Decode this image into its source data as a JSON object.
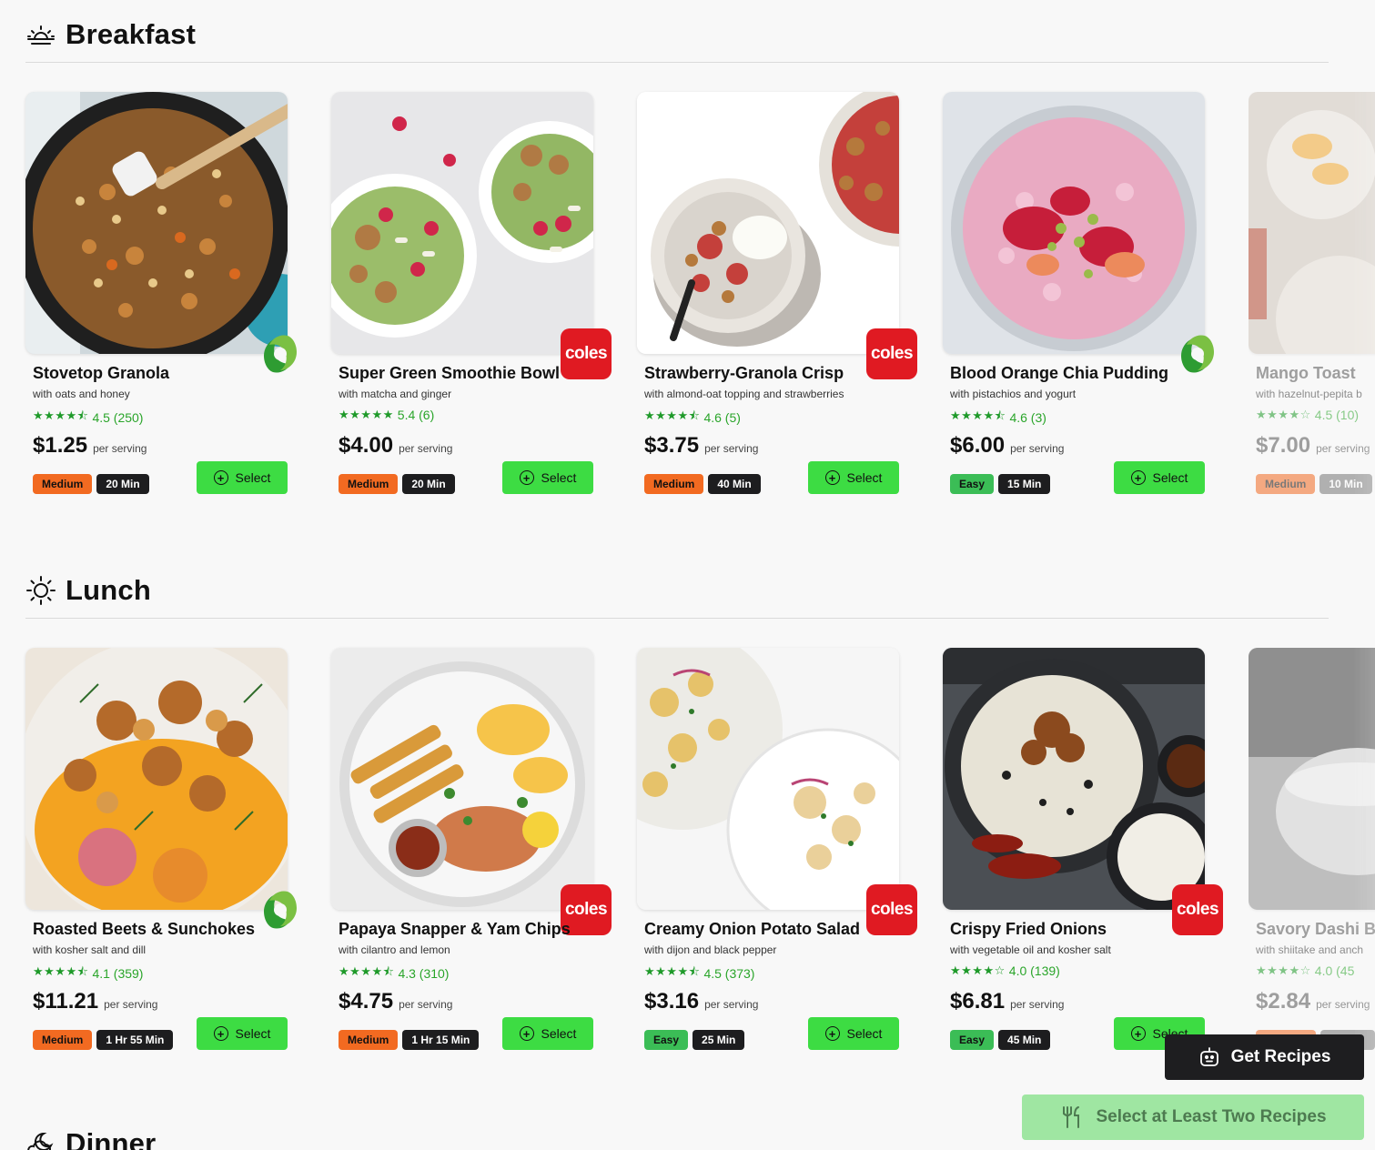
{
  "colors": {
    "accent_green": "#3ddc43",
    "difficulty_medium": "#f26a21",
    "difficulty_easy": "#3bbd56",
    "coles_red": "#e01a22",
    "woolworths_green": "#35a83b"
  },
  "common": {
    "select_label": "Select",
    "per_serving": "per serving"
  },
  "sections": [
    {
      "title": "Breakfast",
      "icon": "sunrise-icon",
      "recipes": [
        {
          "name": "Stovetop Granola",
          "sub": "with oats and honey",
          "stars": "★★★★⯪",
          "rating": "4.5 (250)",
          "price": "$1.25",
          "difficulty": "Medium",
          "time": "20 Min",
          "store": "woolworths",
          "image": "granola-skillet"
        },
        {
          "name": "Super Green Smoothie Bowl",
          "sub": "with matcha and ginger",
          "stars": "★★★★★",
          "rating": "5.4 (6)",
          "price": "$4.00",
          "difficulty": "Medium",
          "time": "20 Min",
          "store": "coles",
          "store_label": "coles",
          "image": "smoothie-bowls"
        },
        {
          "name": "Strawberry-Granola Crisp",
          "sub": "with almond-oat topping and strawberries",
          "stars": "★★★★⯪",
          "rating": "4.6 (5)",
          "price": "$3.75",
          "difficulty": "Medium",
          "time": "40 Min",
          "store": "coles",
          "store_label": "coles",
          "image": "strawberry-crisp"
        },
        {
          "name": "Blood Orange Chia Pudding",
          "sub": "with pistachios and yogurt",
          "stars": "★★★★⯪",
          "rating": "4.6 (3)",
          "price": "$6.00",
          "difficulty": "Easy",
          "time": "15 Min",
          "store": "woolworths",
          "image": "chia-pudding"
        },
        {
          "name": "Mango Toast",
          "sub": "with hazelnut-pepita b",
          "stars": "★★★★☆",
          "rating": "4.5 (10)",
          "price": "$7.00",
          "difficulty": "Medium",
          "time": "10 Min",
          "store": "",
          "image": "mango-toast"
        }
      ]
    },
    {
      "title": "Lunch",
      "icon": "sun-icon",
      "recipes": [
        {
          "name": "Roasted Beets & Sunchokes",
          "sub": "with kosher salt and dill",
          "stars": "★★★★⯪",
          "rating": "4.1 (359)",
          "price": "$11.21",
          "difficulty": "Medium",
          "time": "1 Hr 55 Min",
          "store": "woolworths",
          "image": "roasted-beets"
        },
        {
          "name": "Papaya Snapper & Yam Chips",
          "sub": "with cilantro and lemon",
          "stars": "★★★★⯪",
          "rating": "4.3 (310)",
          "price": "$4.75",
          "difficulty": "Medium",
          "time": "1 Hr 15 Min",
          "store": "coles",
          "store_label": "coles",
          "image": "snapper-chips"
        },
        {
          "name": "Creamy Onion Potato Salad",
          "sub": "with dijon and black pepper",
          "stars": "★★★★⯪",
          "rating": "4.5 (373)",
          "price": "$3.16",
          "difficulty": "Easy",
          "time": "25 Min",
          "store": "coles",
          "store_label": "coles",
          "image": "potato-salad"
        },
        {
          "name": "Crispy Fried Onions",
          "sub": "with vegetable oil and kosher salt",
          "stars": "★★★★☆",
          "rating": "4.0 (139)",
          "price": "$6.81",
          "difficulty": "Easy",
          "time": "45 Min",
          "store": "coles",
          "store_label": "coles",
          "image": "fried-onions"
        },
        {
          "name": "Savory Dashi B",
          "sub": "with shiitake and anch",
          "stars": "★★★★☆",
          "rating": "4.0 (45",
          "price": "$2.84",
          "difficulty": "",
          "time": "",
          "store": "",
          "image": "dashi-pot"
        }
      ]
    },
    {
      "title": "Dinner",
      "icon": "moon-cloud-icon",
      "recipes": []
    }
  ],
  "actions": {
    "get_recipes": "Get Recipes",
    "select_two": "Select at Least Two Recipes"
  }
}
